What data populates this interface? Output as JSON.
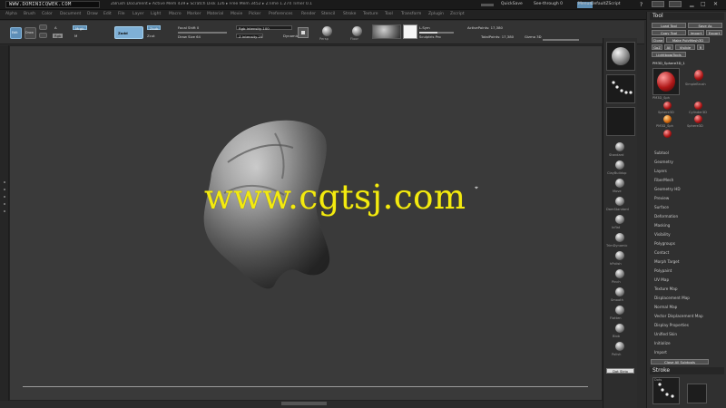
{
  "titlebar": {
    "brand": "WWW.DOMINICQWEK.COM",
    "info": "ZBrush Document  ▸ Active Mem 439 ▸ Scratch Disk 126 ▸ Free Mem 3452 ▸ ZTime 1.274  Timer 0.1",
    "quicksave": "QuickSave",
    "seethrough": "See-through 0",
    "menus": "Menus",
    "defaultscript": "DefaultZScript"
  },
  "menubar": {
    "items": [
      "Alpha",
      "Brush",
      "Color",
      "Document",
      "Draw",
      "Edit",
      "File",
      "Layer",
      "Light",
      "Macro",
      "Marker",
      "Material",
      "Movie",
      "Picker",
      "Preferences",
      "Render",
      "Stencil",
      "Stroke",
      "Texture",
      "Tool",
      "Transform",
      "Zplugin",
      "Zscript"
    ]
  },
  "shelf": {
    "a": "A",
    "mrgb": "Mrgb",
    "rgb": "Rgb",
    "m": "M",
    "zadd": "Zadd",
    "zsub": "Zsub",
    "zcut": "Zcut",
    "focal_label": "Focal Shift 0",
    "draw_size_label": "Draw Size 64",
    "dynamic": "Dynamic",
    "rgb_intensity": "Rgb Intensity 100",
    "z_intensity": "Z Intensity 25",
    "active_points": "ActivePoints: 17,380",
    "total_points": "TotalPoints: 17,380",
    "persp": "Persp",
    "floor": "Floor",
    "lsym": "L.Sym",
    "sculptris": "Sculptris Pro",
    "edit": "Edit",
    "draw": "Draw",
    "move": "Move",
    "scale": "Scale",
    "rotate": "Rotate",
    "gizmo": "Gizmo 3D"
  },
  "canvas": {
    "watermark": "www.cgtsj.com"
  },
  "rightstrip": {
    "brushes": [
      "Standard",
      "ClayBuildup",
      "Move",
      "DamStandard",
      "Inflat",
      "TrimDynamic",
      "hPolish",
      "Pinch",
      "Smooth",
      "Flatten",
      "Blob",
      "Polish"
    ],
    "bottom_btn": "Dot Strip"
  },
  "toolpanel": {
    "title": "Tool",
    "buttons": [
      "Load Tool",
      "Save As",
      "Copy Tool",
      "Import",
      "Export",
      "Clone",
      "Make PolyMesh3D",
      "GoZ",
      "All",
      "Visible",
      "R",
      "Lightbox▸Tools"
    ],
    "current_tool": "PM3D_Sphere3D_1",
    "thumbs": [
      "PM3D_Sph",
      "SimpleBrush",
      "Sphere3D",
      "Cylinder3D",
      "PM3D_Sph",
      "Sphere3D"
    ],
    "list": [
      "Subtool",
      "Geometry",
      "Layers",
      "FiberMesh",
      "Geometry HD",
      "Preview",
      "Surface",
      "Deformation",
      "Masking",
      "Visibility",
      "Polygroups",
      "Contact",
      "Morph Target",
      "Polypaint",
      "UV Map",
      "Texture Map",
      "Displacement Map",
      "Normal Map",
      "Vector Displacement Map",
      "Display Properties",
      "Unified Skin",
      "Initialize",
      "Import",
      "Export"
    ],
    "subtool_btn": "Close All Subtools",
    "stroke_title": "Stroke",
    "stroke_sub": "Dots"
  }
}
